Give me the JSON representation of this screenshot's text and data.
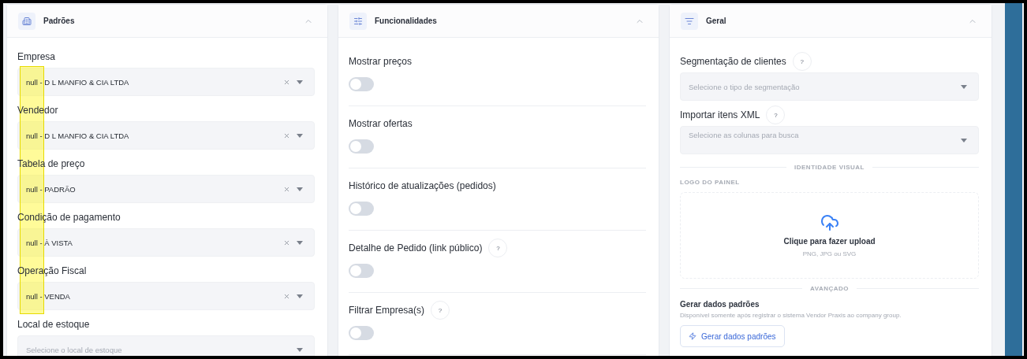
{
  "panels": [
    {
      "kind": "defaults",
      "title": "Padrões",
      "expanded": true,
      "highlight": {
        "kind": "rectangle"
      },
      "fields": [
        {
          "label": "Empresa",
          "value": "null - D L MANFIO & CIA LTDA"
        },
        {
          "label": "Vendedor",
          "value": "null - D L MANFIO & CIA LTDA"
        },
        {
          "label": "Tabela de preço",
          "value": "null - PADRÃO"
        },
        {
          "label": "Condição de pagamento",
          "value": "null - À VISTA"
        },
        {
          "label": "Operação Fiscal",
          "value": "null - VENDA"
        },
        {
          "label": "Local de estoque",
          "placeholder": "Selecione o local de estoque"
        }
      ]
    },
    {
      "kind": "features",
      "title": "Funcionalidades",
      "expanded": true,
      "toggles": [
        {
          "label": "Mostrar preços",
          "on": false
        },
        {
          "label": "Mostrar ofertas",
          "on": false
        },
        {
          "label": "Histórico de atualizações (pedidos)",
          "on": false
        },
        {
          "label": "Detalhe de Pedido (link público)",
          "help": "?",
          "on": false
        },
        {
          "label": "Filtrar Empresa(s)",
          "help": "?",
          "on": false
        }
      ]
    },
    {
      "kind": "general",
      "title": "Geral",
      "expanded": true,
      "fields": [
        {
          "label": "Segmentação de clientes",
          "help": "?",
          "placeholder": "Selecione o tipo de segmentação"
        },
        {
          "label": "Importar itens XML",
          "help": "?",
          "placeholder": "Selecione as colunas para busca"
        }
      ],
      "visual_identity": {
        "heading": "IDENTIDADE VISUAL",
        "logo_label": "LOGO DO PAINEL",
        "upload_title": "Clique para fazer upload",
        "upload_hint": "PNG, JPG ou SVG"
      },
      "advanced": {
        "heading": "AVANÇADO",
        "title": "Gerar dados padrões",
        "description": "Disponível somente após registrar o sistema Vendor Praxis ao company group.",
        "button": "Gerar dados padrões"
      }
    }
  ]
}
